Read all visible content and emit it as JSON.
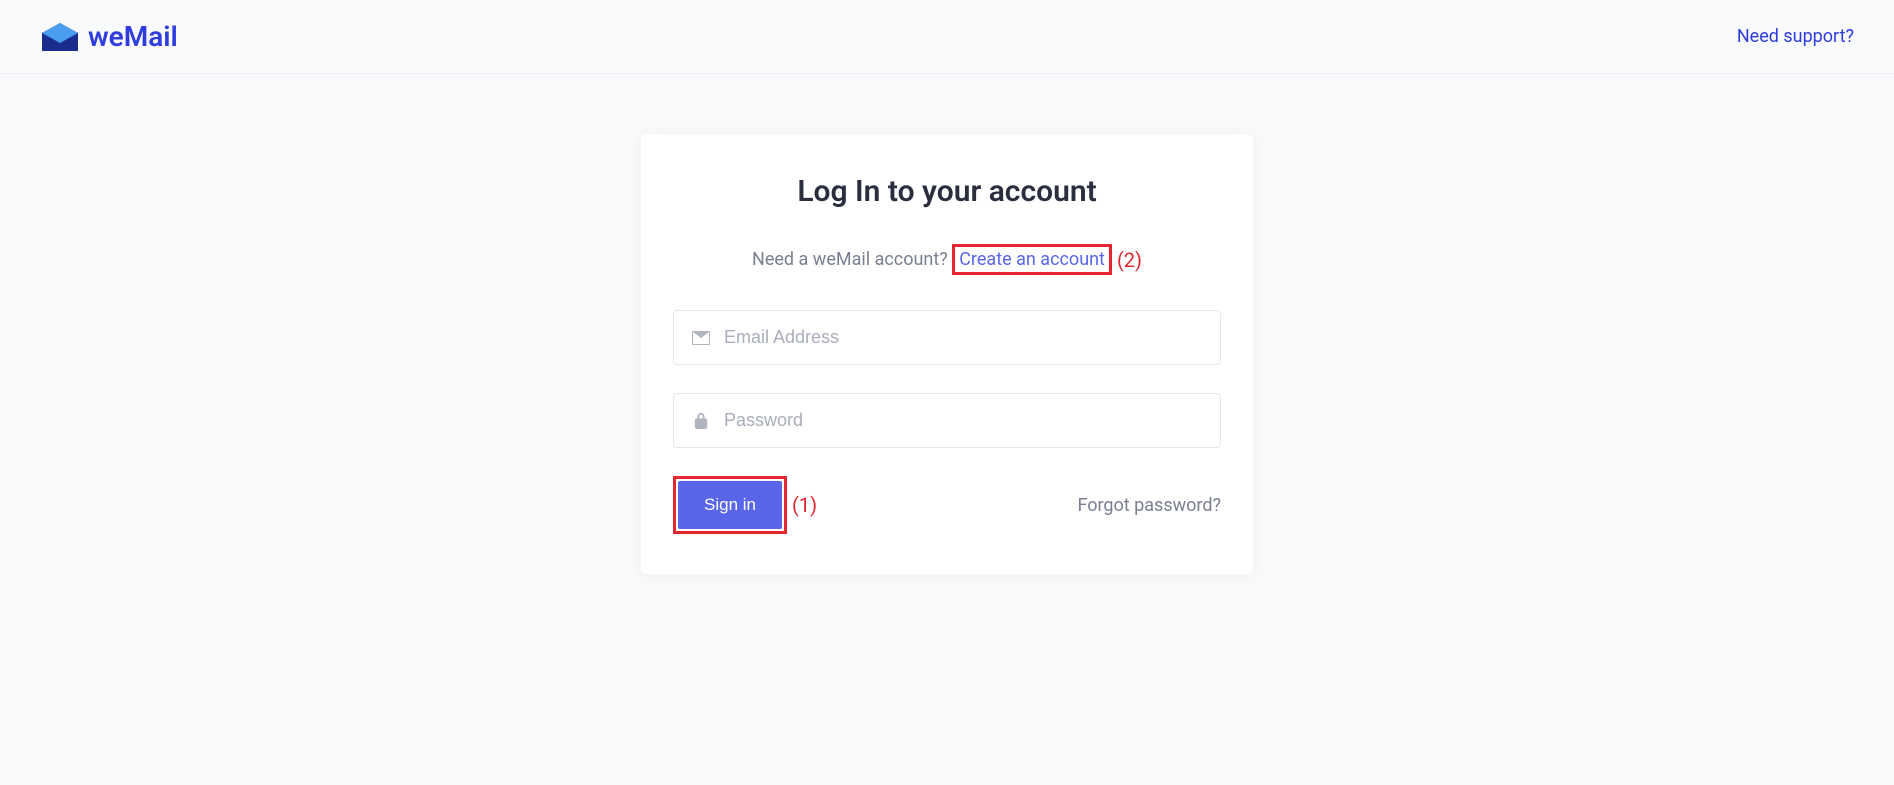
{
  "header": {
    "brand_name": "weMail",
    "support_link": "Need support?"
  },
  "login": {
    "title": "Log In to your account",
    "need_account_text": "Need a weMail account?",
    "create_account_link": "Create an account",
    "email_placeholder": "Email Address",
    "password_placeholder": "Password",
    "signin_label": "Sign in",
    "forgot_password": "Forgot password?"
  },
  "annotations": {
    "signin": "(1)",
    "create_account": "(2)"
  }
}
